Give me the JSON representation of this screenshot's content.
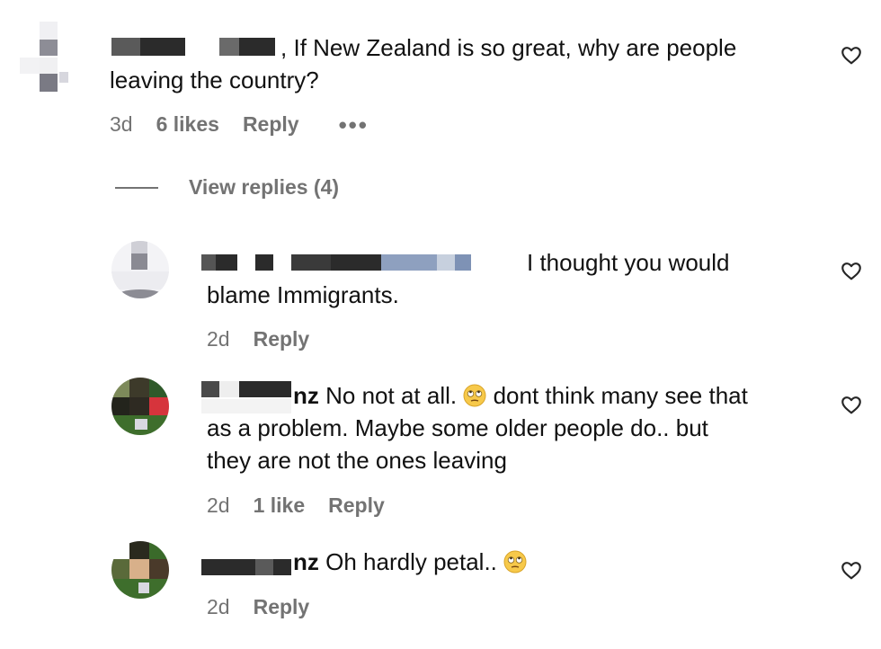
{
  "colors": {
    "text": "#111111",
    "meta": "#737373",
    "redaction": "#2b2b2b",
    "redaction_blue": "#7e92b5"
  },
  "icons": {
    "like": "heart-outline-icon",
    "more": "more-horizontal-icon",
    "emoji": "face-with-rolling-eyes-emoji"
  },
  "comments": [
    {
      "username": "",
      "text": "If New Zealand is so great, why are people",
      "text_cont": "leaving the country?",
      "separator": ",",
      "time": "3d",
      "likes": "6 likes",
      "reply": "Reply",
      "more": "•••",
      "view_replies": "View replies (4)"
    },
    {
      "username": "",
      "text": "I thought you would",
      "text_cont": "blame Immigrants.",
      "time": "2d",
      "reply": "Reply"
    },
    {
      "username_suffix": "nz",
      "text": "No not at all.",
      "text_after_emoji": "dont think many see that",
      "text_cont": "as a problem. Maybe some older people do.. but",
      "text_cont2": "they are not the ones leaving",
      "time": "2d",
      "likes": "1 like",
      "reply": "Reply"
    },
    {
      "username_suffix": "nz",
      "text": "Oh hardly petal..",
      "time": "2d",
      "reply": "Reply"
    }
  ]
}
